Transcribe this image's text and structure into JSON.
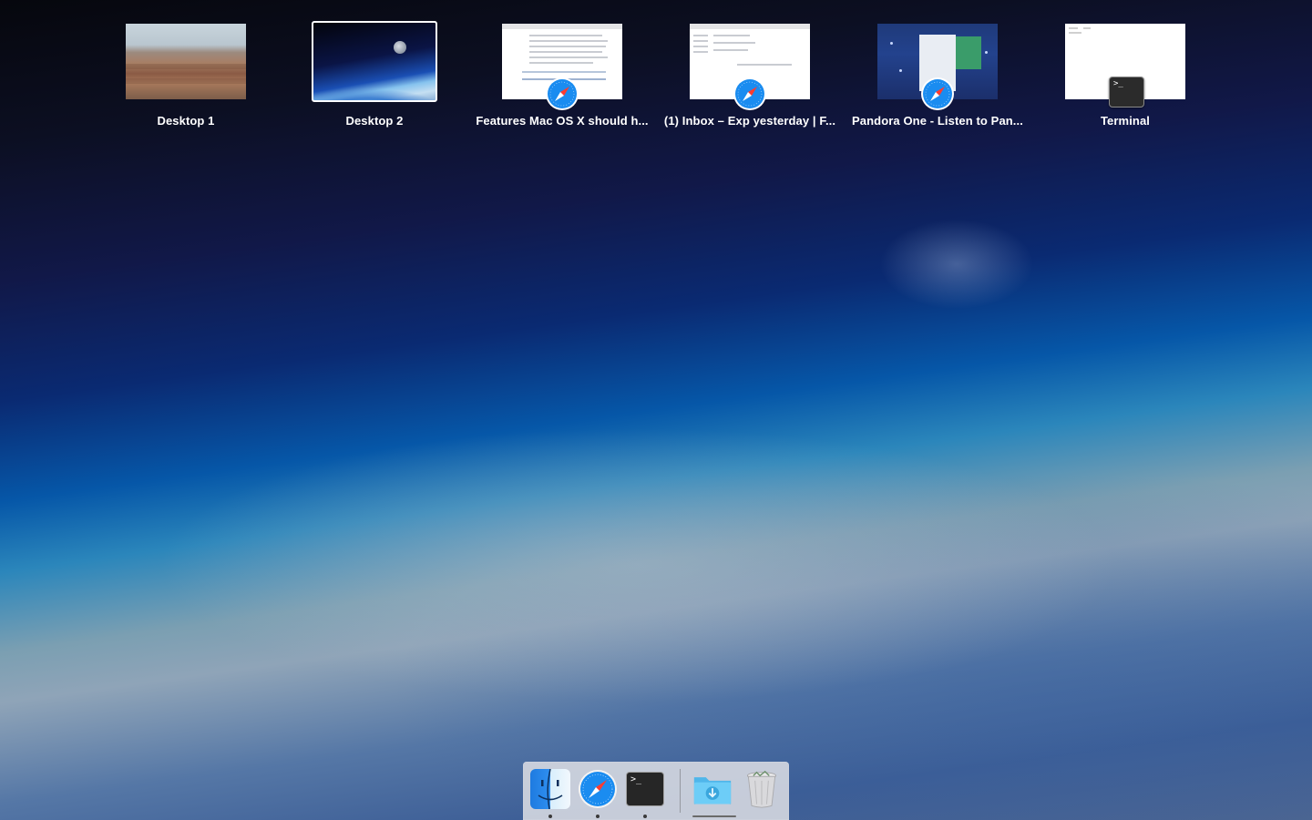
{
  "mission_control": {
    "spaces": [
      {
        "label": "Desktop 1",
        "kind": "desktop",
        "current": false
      },
      {
        "label": "Desktop 2",
        "kind": "desktop",
        "current": true
      },
      {
        "label": "Features Mac OS X should h...",
        "kind": "app-window",
        "app_icon": "safari-icon"
      },
      {
        "label": "(1) Inbox – Exp yesterday | F...",
        "kind": "app-window",
        "app_icon": "safari-icon"
      },
      {
        "label": "Pandora One - Listen to Pan...",
        "kind": "app-window",
        "app_icon": "safari-icon"
      },
      {
        "label": "Terminal",
        "kind": "app-window",
        "app_icon": "terminal-icon"
      }
    ]
  },
  "terminal_prompt_glyph": ">_",
  "dock": {
    "apps": [
      {
        "name": "Finder",
        "icon": "finder-icon",
        "running": true
      },
      {
        "name": "Safari",
        "icon": "safari-icon",
        "running": true
      },
      {
        "name": "Terminal",
        "icon": "terminal-icon",
        "running": true
      }
    ],
    "stacks": [
      {
        "name": "Downloads",
        "icon": "downloads-folder-icon"
      },
      {
        "name": "Trash",
        "icon": "trash-icon"
      }
    ]
  },
  "colors": {
    "label_text": "#ffffff",
    "current_space_border": "#ffffff",
    "dock_background": "#dadce2",
    "safari_blue": "#1a8cf0",
    "downloads_folder": "#5cc6f5"
  }
}
